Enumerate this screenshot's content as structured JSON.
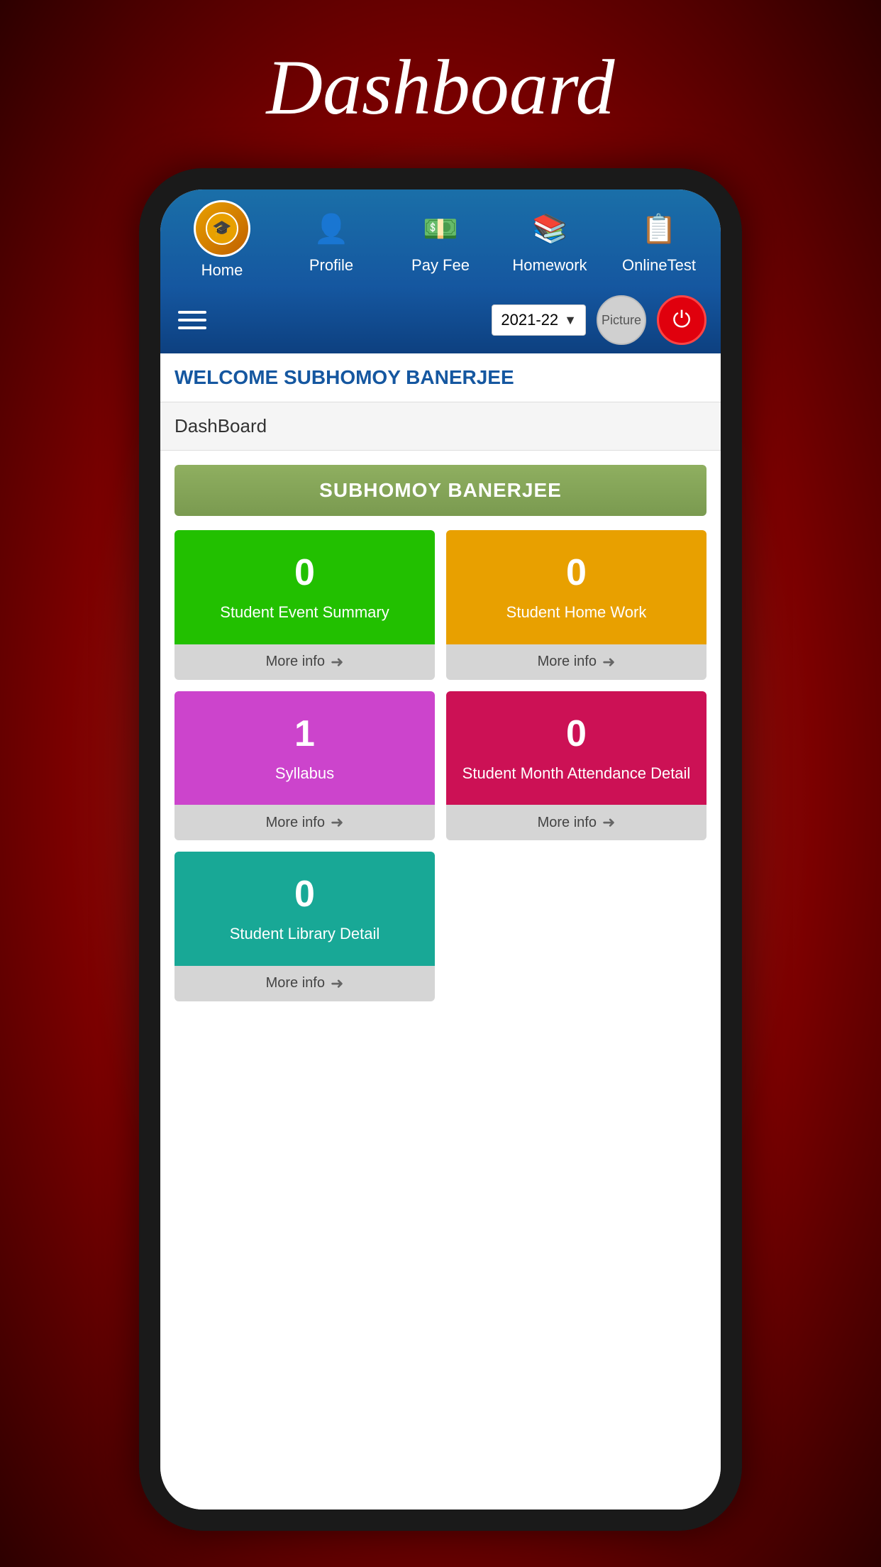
{
  "app": {
    "title": "Dashboard"
  },
  "header": {
    "title": "Dashboard"
  },
  "nav": {
    "items": [
      {
        "id": "home",
        "label": "Home",
        "icon": "🏠"
      },
      {
        "id": "profile",
        "label": "Profile",
        "icon": "👤"
      },
      {
        "id": "payfee",
        "label": "Pay Fee",
        "icon": "💵"
      },
      {
        "id": "homework",
        "label": "Homework",
        "icon": "📚"
      },
      {
        "id": "onlinetest",
        "label": "OnlineTest",
        "icon": "📋"
      }
    ]
  },
  "toolbar": {
    "year": "2021-22",
    "picture_label": "Picture"
  },
  "welcome": {
    "message": "WELCOME SUBHOMOY BANERJEE"
  },
  "breadcrumb": {
    "label": "DashBoard"
  },
  "student": {
    "name": "SUBHOMOY BANERJEE"
  },
  "cards": [
    {
      "id": "student-event",
      "value": "0",
      "label": "Student Event Summary",
      "footer": "More info",
      "color": "green"
    },
    {
      "id": "student-homework",
      "value": "0",
      "label": "Student Home Work",
      "footer": "More info",
      "color": "orange"
    },
    {
      "id": "syllabus",
      "value": "1",
      "label": "Syllabus",
      "footer": "More info",
      "color": "purple"
    },
    {
      "id": "student-attendance",
      "value": "0",
      "label": "Student Month Attendance Detail",
      "footer": "More info",
      "color": "red"
    },
    {
      "id": "student-library",
      "value": "0",
      "label": "Student Library Detail",
      "footer": "More info",
      "color": "teal"
    }
  ]
}
